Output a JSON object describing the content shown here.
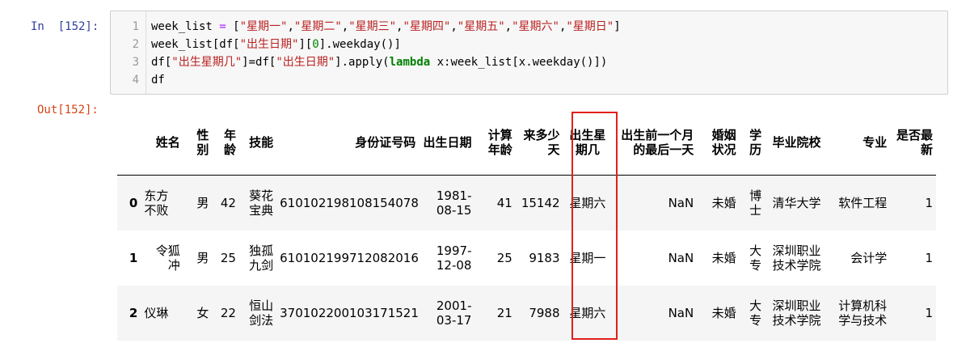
{
  "cell": {
    "in_prompt": "In  [152]:",
    "out_prompt": "Out[152]:",
    "line_numbers": [
      "1",
      "2",
      "3",
      "4"
    ],
    "code": {
      "l1_a": "week_list ",
      "l1_b": "= ",
      "l1_c": "[",
      "l1_s1": "\"星期一\"",
      "l1_s2": "\"星期二\"",
      "l1_s3": "\"星期三\"",
      "l1_s4": "\"星期四\"",
      "l1_s5": "\"星期五\"",
      "l1_s6": "\"星期六\"",
      "l1_s7": "\"星期日\"",
      "comma": ",",
      "l1_d": "]",
      "l2_a": "week_list[df[",
      "l2_s": "\"出生日期\"",
      "l2_b": "][",
      "l2_n": "0",
      "l2_c": "].weekday()]",
      "l3_a": "df[",
      "l3_s1": "\"出生星期几\"",
      "l3_b": "]=df[",
      "l3_s2": "\"出生日期\"",
      "l3_c": "].apply(",
      "l3_k": "lambda",
      "l3_d": " x:week_list[x.weekday()])",
      "l4": "df"
    }
  },
  "table": {
    "columns": [
      "",
      "姓名",
      "性别",
      "年龄",
      "技能",
      "身份证号码",
      "出生日期",
      "计算年龄",
      "来多少天",
      "出生星期几",
      "出生前一个月的最后一天",
      "婚姻状况",
      "学历",
      "毕业院校",
      "专业",
      "是否最新"
    ],
    "rows": [
      {
        "index": "0",
        "name": "东方不败",
        "gender": "男",
        "age": "42",
        "skill": "葵花宝典",
        "id": "610102198108154078",
        "birth": "1981-08-15",
        "calc_age": "41",
        "days": "15142",
        "weekday": "星期六",
        "prev_month_end": "NaN",
        "marital": "未婚",
        "edu": "博士",
        "school": "清华大学",
        "major": "软件工程",
        "latest": "1"
      },
      {
        "index": "1",
        "name": "令狐冲",
        "gender": "男",
        "age": "25",
        "skill": "独孤九剑",
        "id": "610102199712082016",
        "birth": "1997-12-08",
        "calc_age": "25",
        "days": "9183",
        "weekday": "星期一",
        "prev_month_end": "NaN",
        "marital": "未婚",
        "edu": "大专",
        "school": "深圳职业技术学院",
        "major": "会计学",
        "latest": "1"
      },
      {
        "index": "2",
        "name": "仪琳",
        "gender": "女",
        "age": "22",
        "skill": "恒山剑法",
        "id": "370102200103171521",
        "birth": "2001-03-17",
        "calc_age": "21",
        "days": "7988",
        "weekday": "星期六",
        "prev_month_end": "NaN",
        "marital": "未婚",
        "edu": "大专",
        "school": "深圳职业技术学院",
        "major": "计算机科学与技术",
        "latest": "1"
      }
    ]
  },
  "colors": {
    "in_prompt": "#303F9F",
    "out_prompt": "#D84315",
    "string": "#BA2121",
    "keyword": "#008000",
    "highlight_box": "#E0201B"
  }
}
